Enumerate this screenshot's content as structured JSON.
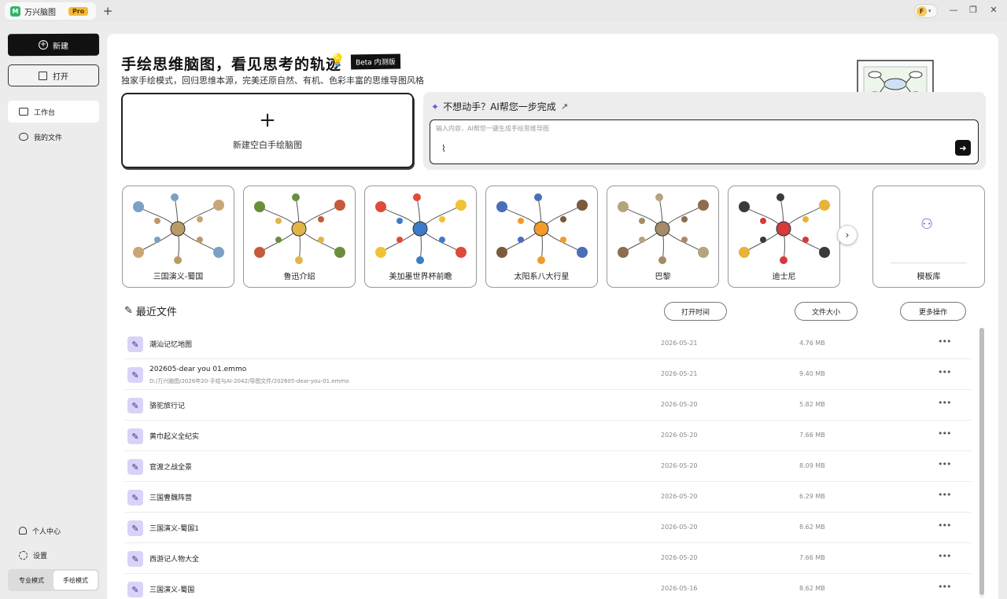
{
  "app": {
    "name": "万兴脑图",
    "badge": "Pro",
    "add_tab": "+",
    "account_initial": "F"
  },
  "sidebar": {
    "new_label": "新建",
    "open_label": "打开",
    "nav": [
      {
        "label": "工作台"
      },
      {
        "label": "我的文件"
      }
    ],
    "bottom": [
      {
        "label": "个人中心"
      },
      {
        "label": "设置"
      }
    ],
    "modes": [
      {
        "label": "专业模式"
      },
      {
        "label": "手绘模式"
      }
    ]
  },
  "hero": {
    "title": "手绘思维脑图，看见思考的轨迹",
    "beta": "Beta 内测版",
    "subtitle": "独家手绘模式，回归思维本源，完美还原自然、有机、色彩丰富的思维导图风格"
  },
  "new_blank": {
    "label": "新建空白手绘脑图"
  },
  "ai": {
    "title": "不想动手？AI帮您一步完成",
    "placeholder": "输入内容，AI帮您一键生成手绘思维导图"
  },
  "templates": [
    {
      "label": "三国演义-蜀国",
      "colors": [
        "#b99b6a",
        "#7aa0c4",
        "#c9a676"
      ]
    },
    {
      "label": "鲁迅介绍",
      "colors": [
        "#e2b44a",
        "#6b8e3d",
        "#c65a3a"
      ]
    },
    {
      "label": "美加墨世界杯前瞻",
      "colors": [
        "#3d7cc9",
        "#e04a3a",
        "#f2c230"
      ]
    },
    {
      "label": "太阳系八大行星",
      "colors": [
        "#f29b2a",
        "#4a6fb8",
        "#7a5a3a"
      ]
    },
    {
      "label": "巴黎",
      "colors": [
        "#a68b6a",
        "#b5a47f",
        "#8c6d4d"
      ]
    },
    {
      "label": "迪士尼",
      "colors": [
        "#d63a3a",
        "#3a3a3a",
        "#e8b33a"
      ]
    }
  ],
  "template_library": {
    "label": "模板库"
  },
  "recent": {
    "title": "最近文件",
    "headers": {
      "time": "打开时间",
      "size": "文件大小",
      "more": "更多操作"
    },
    "files": [
      {
        "name": "潮汕记忆地图",
        "path": "",
        "date": "2026-05-21",
        "size": "4.76 MB"
      },
      {
        "name": "202605-dear you 01.emmo",
        "path": "D:/万兴脑图/2026年20-手绘与AI-2042/导图文件/202605-dear-you-01.emmo",
        "date": "2026-05-21",
        "size": "9.40 MB"
      },
      {
        "name": "骆驼旅行记",
        "path": "",
        "date": "2026-05-20",
        "size": "5.82 MB"
      },
      {
        "name": "黄巾起义全纪实",
        "path": "",
        "date": "2026-05-20",
        "size": "7.66 MB"
      },
      {
        "name": "官渡之战全景",
        "path": "",
        "date": "2026-05-20",
        "size": "8.09 MB"
      },
      {
        "name": "三国曹魏阵营",
        "path": "",
        "date": "2026-05-20",
        "size": "6.29 MB"
      },
      {
        "name": "三国演义-蜀国1",
        "path": "",
        "date": "2026-05-20",
        "size": "8.62 MB"
      },
      {
        "name": "西游记人物大全",
        "path": "",
        "date": "2026-05-20",
        "size": "7.66 MB"
      },
      {
        "name": "三国演义-蜀国",
        "path": "",
        "date": "2026-05-16",
        "size": "8.62 MB"
      }
    ]
  }
}
